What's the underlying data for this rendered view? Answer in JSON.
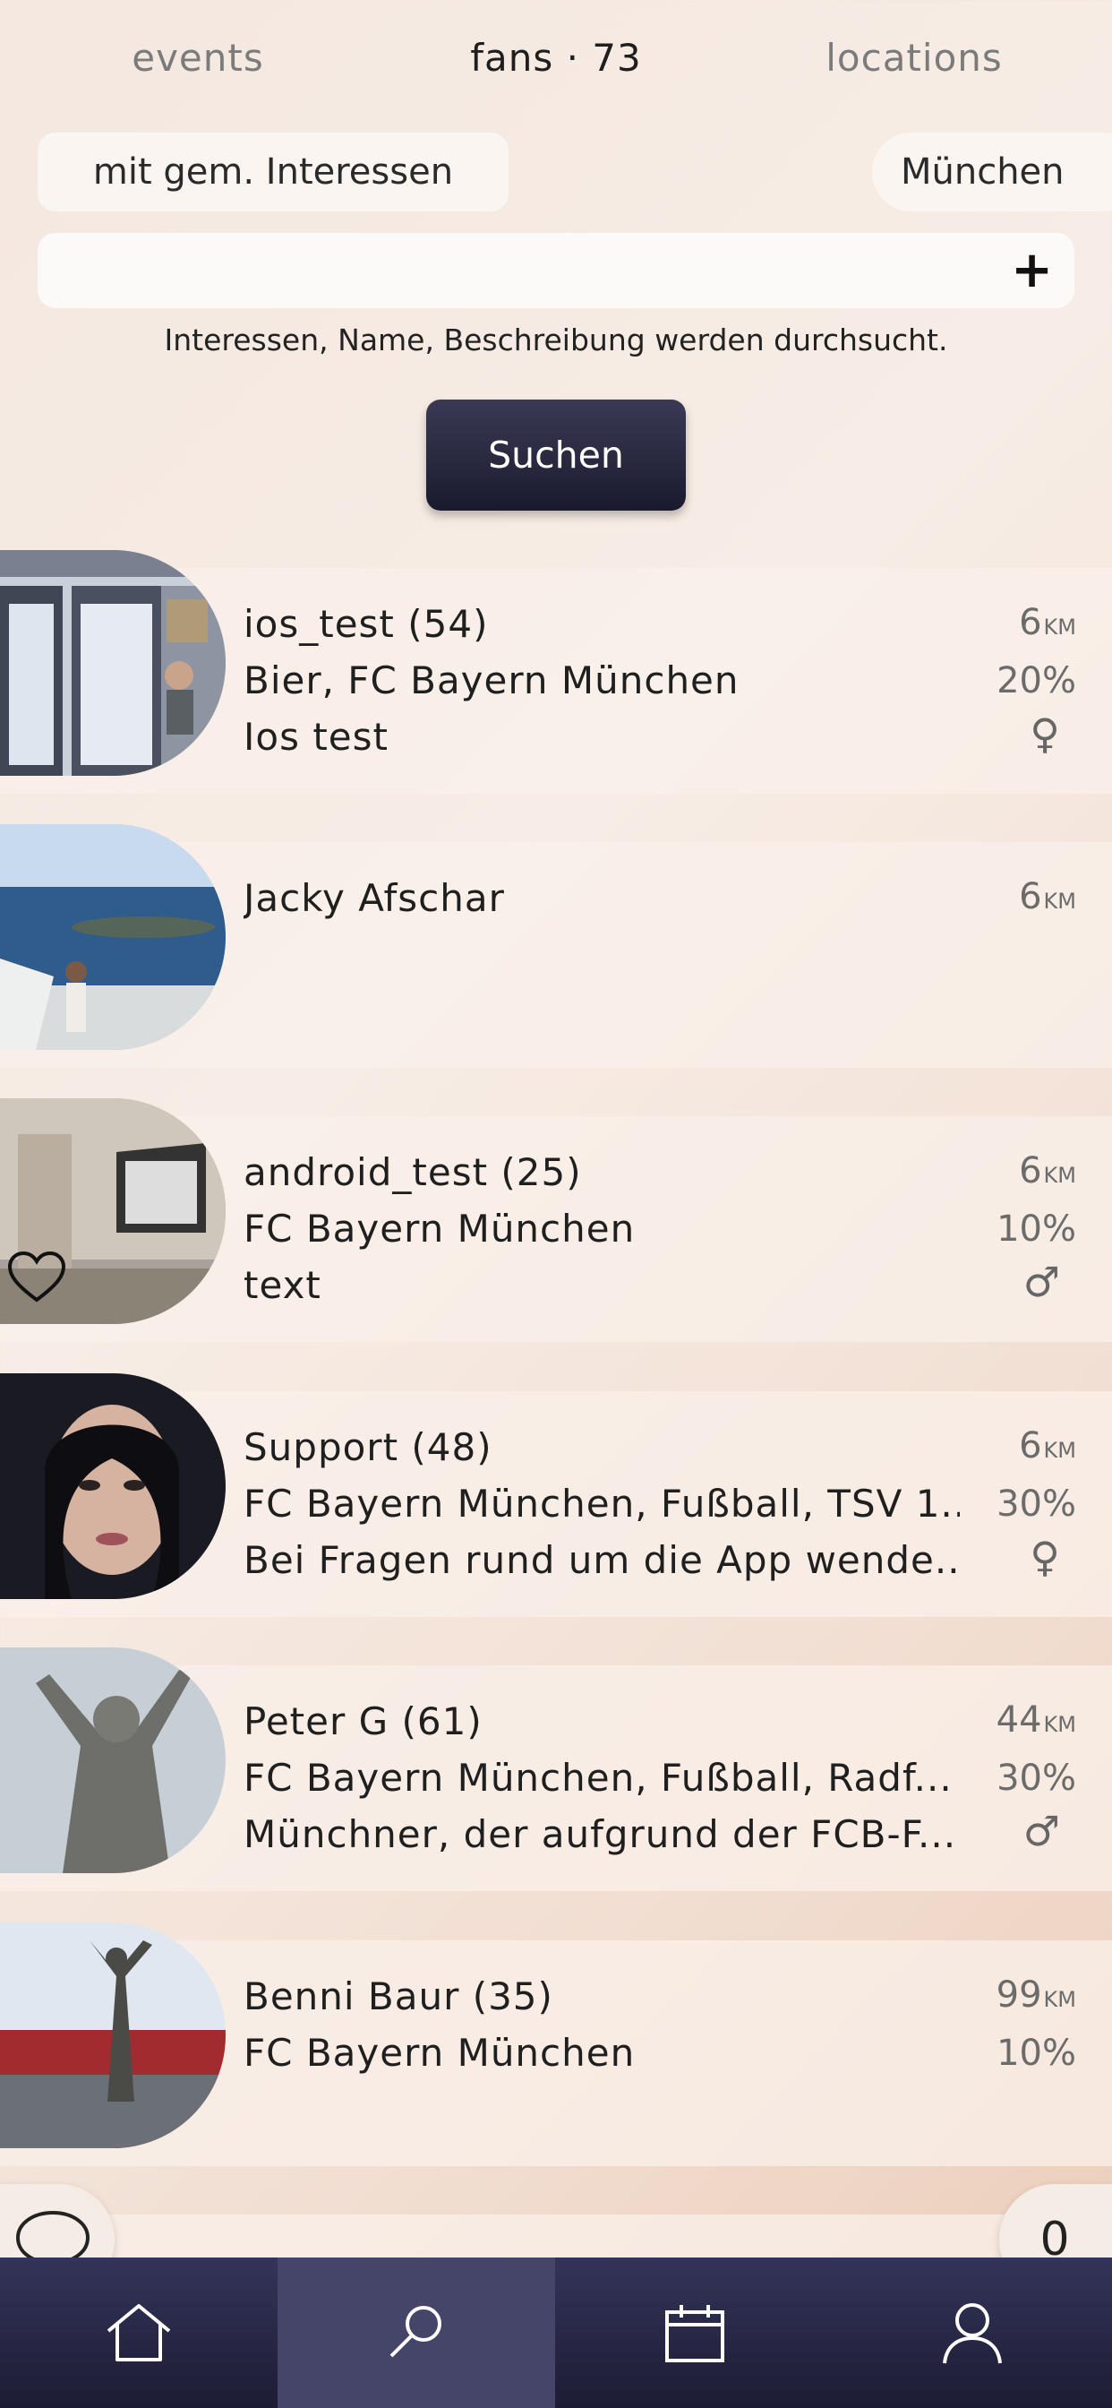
{
  "tabs": [
    {
      "label": "events"
    },
    {
      "label": "fans · 73"
    },
    {
      "label": "locations"
    }
  ],
  "filters": {
    "interests_label": "mit gem. Interessen",
    "city_label": "München"
  },
  "search": {
    "placeholder": "",
    "add_icon": "plus-icon",
    "hint": "Interessen, Name, Beschreibung werden durchsucht.",
    "button_label": "Suchen"
  },
  "fans": [
    {
      "name": "ios_test (54)",
      "interests": "Bier, FC Bayern München",
      "description": "Ios test",
      "distance": "6",
      "unit": "KM",
      "match": "20%",
      "gender": "♀"
    },
    {
      "name": "Jacky Afschar",
      "interests": "",
      "description": "",
      "distance": "6",
      "unit": "KM",
      "match": "",
      "gender": ""
    },
    {
      "name": "android_test (25)",
      "interests": "FC Bayern München",
      "description": "text",
      "distance": "6",
      "unit": "KM",
      "match": "10%",
      "gender": "♂",
      "favorite_icon": "heart-icon"
    },
    {
      "name": "Support (48)",
      "interests": "FC Bayern München, Fußball, TSV 1...",
      "description": "Bei Fragen rund um die App wende...",
      "distance": "6",
      "unit": "KM",
      "match": "30%",
      "gender": "♀"
    },
    {
      "name": "Peter G (61)",
      "interests": "FC Bayern München, Fußball, Radf...",
      "description": "Münchner, der aufgrund der FCB-F...",
      "distance": "44",
      "unit": "KM",
      "match": "30%",
      "gender": "♂"
    },
    {
      "name": "Benni Baur (35)",
      "interests": "FC Bayern München",
      "description": "",
      "distance": "99",
      "unit": "KM",
      "match": "10%",
      "gender": ""
    }
  ],
  "chat": {
    "icon": "chat-bubble-icon"
  },
  "notifications": {
    "count": "0"
  },
  "nav": [
    {
      "icon": "home-icon"
    },
    {
      "icon": "search-icon"
    },
    {
      "icon": "calendar-icon"
    },
    {
      "icon": "profile-icon"
    }
  ],
  "colors": {
    "button_bg": "#1a1a2e",
    "nav_bg": "#24243e",
    "nav_active": "#45456a"
  }
}
